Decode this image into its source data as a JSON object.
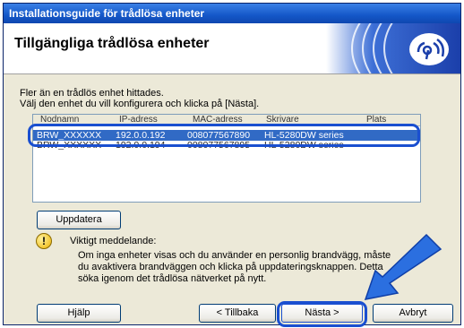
{
  "window": {
    "title": "Installationsguide för trådlösa enheter"
  },
  "banner": {
    "title": "Tillgängliga trådlösa enheter"
  },
  "instructions": {
    "line1": "Fler än en trådlös enhet hittades.",
    "line2": "Välj den enhet du vill konfigurera och klicka på [Nästa]."
  },
  "device_list": {
    "columns": [
      "Nodnamn",
      "IP-adress",
      "MAC-adress",
      "Skrivare",
      "Plats"
    ],
    "rows": [
      {
        "node": "BRW_XXXXXX",
        "ip": "192.0.0.192",
        "mac": "008077567890",
        "printer": "HL-5280DW series",
        "selected": true
      },
      {
        "node": "BRW_XXXXXX",
        "ip": "192.0.0.194",
        "mac": "008077567895",
        "printer": "HL-5280DW series",
        "selected": false
      }
    ]
  },
  "buttons": {
    "update_label": "Uppdatera",
    "help_label": "Hjälp",
    "back_label": "< Tillbaka",
    "next_label": "Nästa >",
    "cancel_label": "Avbryt"
  },
  "note": {
    "title": "Viktigt meddelande:",
    "line1": "Om inga enheter visas och du använder en personlig brandvägg, måste",
    "line2": "du avaktivera brandväggen och klicka på uppdateringsknappen. Detta",
    "line3": "söka igenom det trådlösa nätverket på nytt."
  },
  "colors": {
    "accent": "#1a4fd0",
    "selection": "#316ac5",
    "titlebar": "#1457c8"
  },
  "icons": {
    "wireless_logo": "wireless-signal-icon",
    "info": "exclamation-icon"
  }
}
